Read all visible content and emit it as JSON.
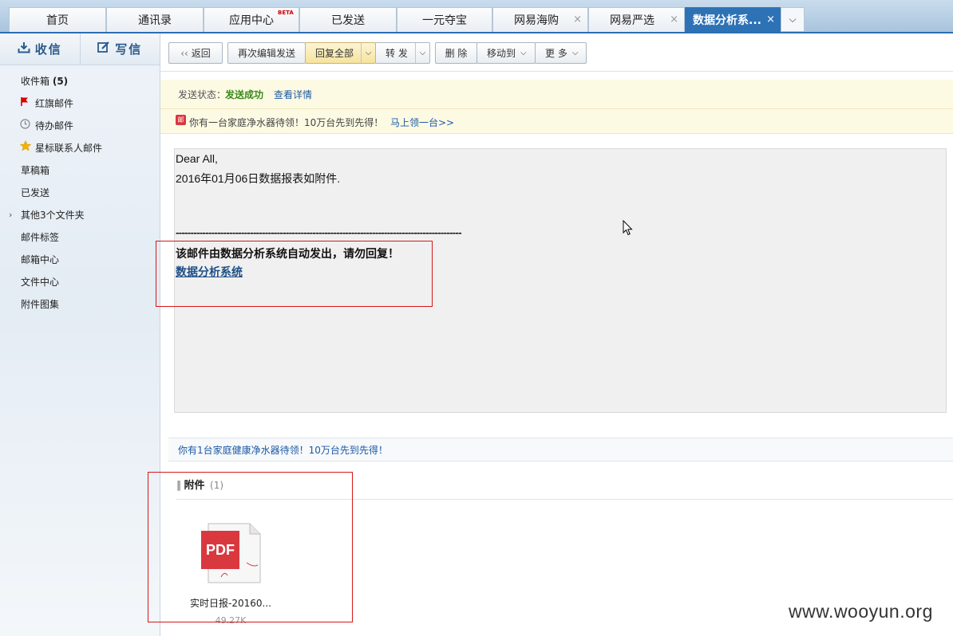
{
  "tabs": [
    {
      "label": "首页"
    },
    {
      "label": "通讯录"
    },
    {
      "label": "应用中心",
      "badge": "BETA"
    },
    {
      "label": "已发送"
    },
    {
      "label": "一元夺宝"
    },
    {
      "label": "网易海购",
      "close": "×"
    },
    {
      "label": "网易严选",
      "close": "×"
    },
    {
      "label": "数据分析系...",
      "close": "×"
    }
  ],
  "sidebar": {
    "receive": "收信",
    "write": "写信",
    "inbox_label": "收件箱",
    "inbox_count": "(5)",
    "items": [
      {
        "label": "红旗邮件",
        "icon": "flag-icon"
      },
      {
        "label": "待办邮件",
        "icon": "clock-icon"
      },
      {
        "label": "星标联系人邮件",
        "icon": "star-icon"
      },
      {
        "label": "草稿箱"
      },
      {
        "label": "已发送"
      },
      {
        "label": "其他3个文件夹"
      },
      {
        "label": "邮件标签"
      },
      {
        "label": "邮箱中心"
      },
      {
        "label": "文件中心"
      },
      {
        "label": "附件图集"
      }
    ]
  },
  "toolbar": {
    "back": "返回",
    "reedit": "再次编辑发送",
    "reply_all": "回复全部",
    "forward": "转 发",
    "delete": "删 除",
    "move": "移动到",
    "more": "更 多"
  },
  "status": {
    "label": "发送状态：",
    "value": "发送成功",
    "detail": "查看详情"
  },
  "ad": {
    "text": "你有一台家庭净水器待领！10万台先到先得！",
    "link": "马上领一台>>"
  },
  "mail": {
    "greeting": "Dear All,",
    "line1": "2016年01月06日数据报表如附件.",
    "divider": "------------------------------------------------------------------------------------------------",
    "notice": "该邮件由数据分析系统自动发出，请勿回复！",
    "system_link": "数据分析系统"
  },
  "bottom_ad": "你有1台家庭健康净水器待领！10万台先到先得！",
  "attachments": {
    "heading": "附件",
    "count": "(1)",
    "file_type": "PDF",
    "file_name": "实时日报-20160...",
    "file_size": "49.27K"
  },
  "watermark": "www.wooyun.org",
  "colors": {
    "accent": "#2e72b6",
    "success": "#3a8a1c",
    "link": "#1d5aa6",
    "annotation": "#d61818",
    "pdf": "#d9383f"
  }
}
